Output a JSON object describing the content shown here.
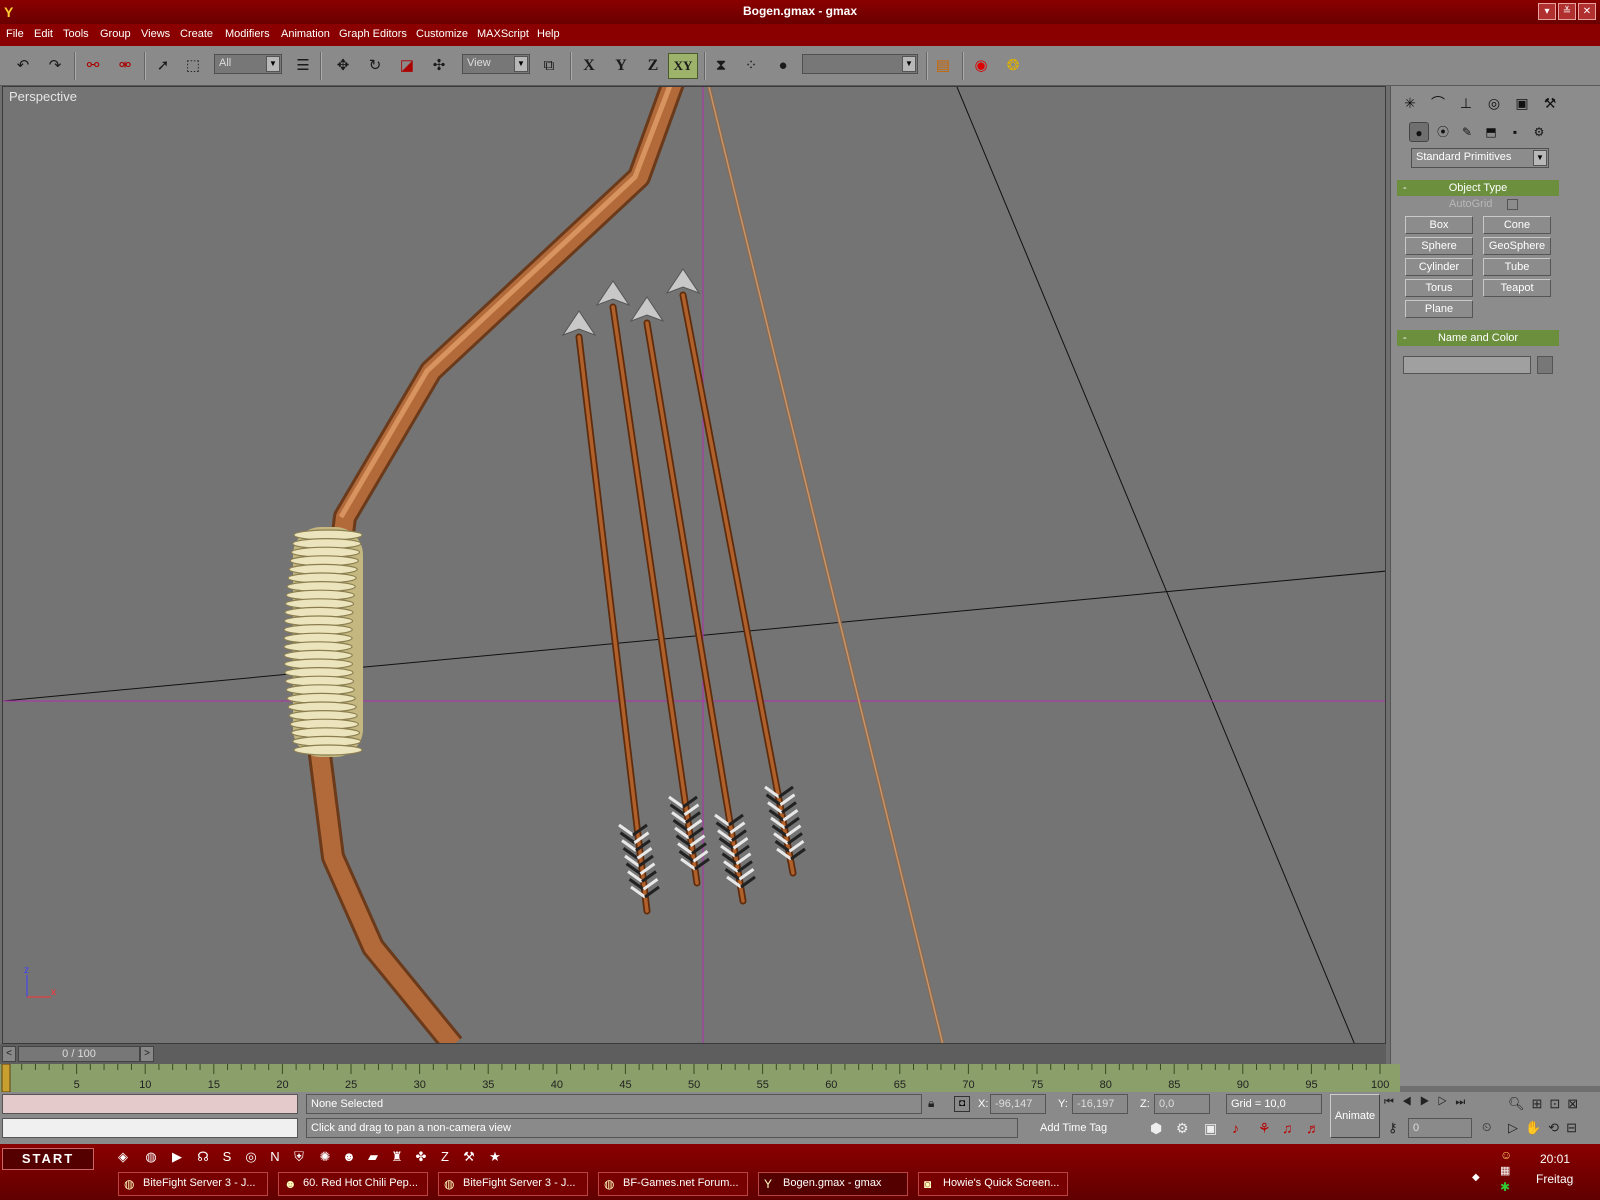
{
  "window": {
    "title": "Bogen.gmax - gmax",
    "icon": "gmax-logo-icon"
  },
  "menu": [
    "File",
    "Edit",
    "Tools",
    "Group",
    "Views",
    "Create",
    "Modifiers",
    "Animation",
    "Graph Editors",
    "Customize",
    "MAXScript",
    "Help"
  ],
  "toolbar": {
    "selection_filter": "All",
    "ref_coord": "View",
    "axis_x": "X",
    "axis_y": "Y",
    "axis_z": "Z",
    "axis_xy": "XY",
    "named_selection": ""
  },
  "viewport": {
    "label": "Perspective",
    "gizmo_x": "x",
    "gizmo_z": "z"
  },
  "command_panel": {
    "category": "Standard Primitives",
    "object_type_title": "Object Type",
    "autogrid": "AutoGrid",
    "buttons": [
      "Box",
      "Cone",
      "Sphere",
      "GeoSphere",
      "Cylinder",
      "Tube",
      "Torus",
      "Teapot",
      "Plane"
    ],
    "name_color_title": "Name and Color",
    "name_value": ""
  },
  "time": {
    "slider": "0 / 100",
    "ticks": [
      "5",
      "10",
      "15",
      "20",
      "25",
      "30",
      "35",
      "40",
      "45",
      "50",
      "55",
      "60",
      "65",
      "70",
      "75",
      "80",
      "85",
      "90",
      "95",
      "100"
    ]
  },
  "status": {
    "selection": "None Selected",
    "prompt": "Click and drag to pan a non-camera view",
    "x_label": "X:",
    "x_value": "-96,147",
    "y_label": "Y:",
    "y_value": "-16,197",
    "z_label": "Z:",
    "z_value": "0,0",
    "grid": "Grid = 10,0",
    "animate": "Animate",
    "add_time_tag": "Add Time Tag",
    "frame": "0"
  },
  "taskbar": {
    "start": "START",
    "tasks": [
      {
        "label": "BiteFight Server 3 - J...",
        "icon": "firefox-icon"
      },
      {
        "label": "60. Red Hot Chili Pep...",
        "icon": "winamp-icon"
      },
      {
        "label": "BiteFight Server 3 - J...",
        "icon": "firefox-icon"
      },
      {
        "label": "BF-Games.net Forum...",
        "icon": "firefox-icon"
      },
      {
        "label": "Bogen.gmax - gmax",
        "icon": "gmax-icon"
      },
      {
        "label": "Howie's Quick Screen...",
        "icon": "camera-icon"
      }
    ],
    "clock_time": "20:01",
    "clock_day": "Freitag"
  },
  "colors": {
    "title_bar": "#8a0000",
    "viewport_bg": "#747474",
    "rollout": "#6b8f3c",
    "bow": "#b26a3a",
    "grip": "#e6dcb0",
    "arrow_shaft": "#a0521e"
  }
}
